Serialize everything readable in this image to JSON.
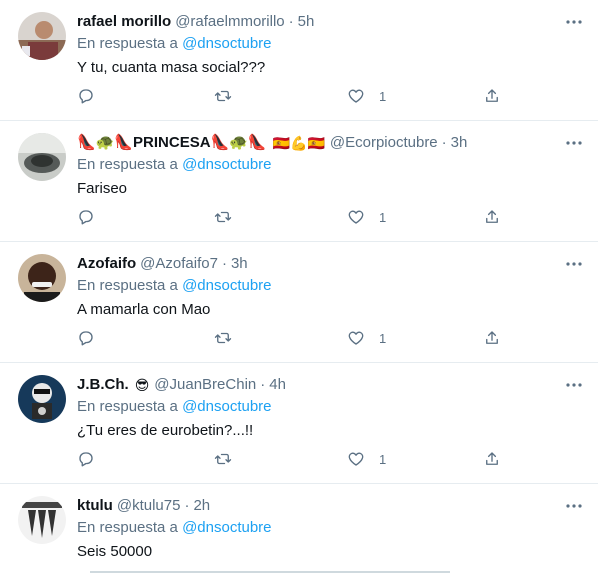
{
  "tweets": [
    {
      "name": "rafael morillo",
      "name_emojis": "",
      "handle": "@rafaelmmorillo",
      "time": "5h",
      "reply_prefix": "En respuesta a",
      "reply_to": "@dnsoctubre",
      "text": "Y tu, cuanta masa social???",
      "likes": "1"
    },
    {
      "name": "👠🐢👠PRINCESA👠🐢👠",
      "name_emojis": "🇪🇸💪🇪🇸",
      "handle": "@Ecorpioctubre",
      "time": "3h",
      "reply_prefix": "En respuesta a",
      "reply_to": "@dnsoctubre",
      "text": "Fariseo",
      "likes": "1"
    },
    {
      "name": "Azofaifo",
      "name_emojis": "",
      "handle": "@Azofaifo7",
      "time": "3h",
      "reply_prefix": "En respuesta a",
      "reply_to": "@dnsoctubre",
      "text": "A mamarla con Mao",
      "likes": "1"
    },
    {
      "name": "J.B.Ch.",
      "name_emojis": "😎",
      "handle": "@JuanBreChin",
      "time": "4h",
      "reply_prefix": "En respuesta a",
      "reply_to": "@dnsoctubre",
      "text": "¿Tu eres de eurobetin?...!!",
      "likes": "1"
    },
    {
      "name": "ktulu",
      "name_emojis": "",
      "handle": "@ktulu75",
      "time": "2h",
      "reply_prefix": "En respuesta a",
      "reply_to": "@dnsoctubre",
      "text": "Seis 50000",
      "likes": ""
    }
  ],
  "icons": {
    "reply": "reply-icon",
    "retweet": "retweet-icon",
    "like": "heart-icon",
    "share": "share-icon",
    "more": "more-icon"
  },
  "colors": {
    "accent": "#1da1f2",
    "secondary_text": "#5b7083",
    "divider": "#e6ecf0"
  }
}
